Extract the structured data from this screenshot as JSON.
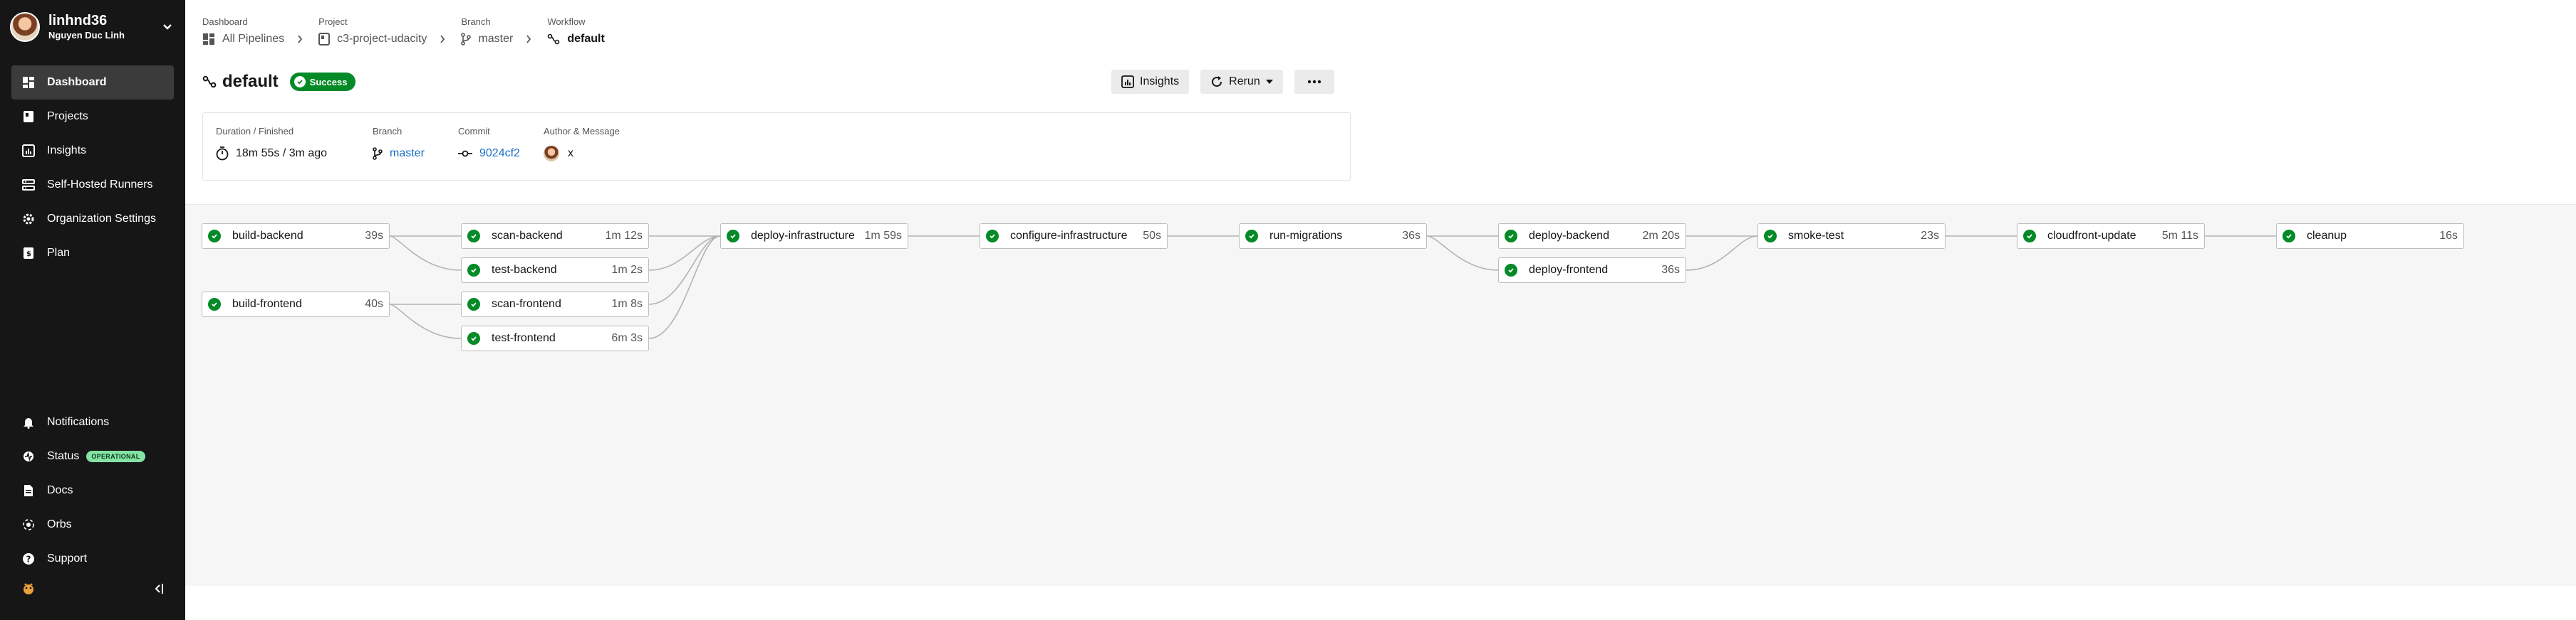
{
  "sidebar": {
    "user_name": "linhnd36",
    "user_full_name": "Nguyen Duc Linh",
    "nav_top": [
      {
        "label": "Dashboard",
        "icon": "dashboard-icon",
        "active": true
      },
      {
        "label": "Projects",
        "icon": "projects-icon"
      },
      {
        "label": "Insights",
        "icon": "insights-icon"
      },
      {
        "label": "Self-Hosted Runners",
        "icon": "runners-icon"
      },
      {
        "label": "Organization Settings",
        "icon": "gear-icon"
      },
      {
        "label": "Plan",
        "icon": "plan-icon"
      }
    ],
    "nav_bottom": [
      {
        "label": "Notifications",
        "icon": "bell-icon"
      },
      {
        "label": "Status",
        "icon": "status-icon",
        "badge": "OPERATIONAL"
      },
      {
        "label": "Docs",
        "icon": "docs-icon"
      },
      {
        "label": "Orbs",
        "icon": "orbs-icon"
      },
      {
        "label": "Support",
        "icon": "help-icon"
      }
    ]
  },
  "breadcrumb": {
    "dashboard": {
      "title": "Dashboard",
      "value": "All Pipelines"
    },
    "project": {
      "title": "Project",
      "value": "c3-project-udacity"
    },
    "branch": {
      "title": "Branch",
      "value": "master"
    },
    "workflow": {
      "title": "Workflow",
      "value": "default"
    }
  },
  "header": {
    "workflow_name": "default",
    "status": "Success",
    "insights_label": "Insights",
    "rerun_label": "Rerun"
  },
  "details": {
    "duration_label": "Duration / Finished",
    "duration_value": "18m 55s / 3m ago",
    "branch_label": "Branch",
    "branch_value": "master",
    "commit_label": "Commit",
    "commit_value": "9024cf2",
    "author_label": "Author & Message",
    "author_message": "x"
  },
  "colors": {
    "success": "#048a26",
    "sidebar_bg": "#161616",
    "link": "#1a6fc6"
  },
  "jobs": [
    {
      "name": "build-backend",
      "duration": "39s"
    },
    {
      "name": "build-frontend",
      "duration": "40s"
    },
    {
      "name": "scan-backend",
      "duration": "1m 12s"
    },
    {
      "name": "test-backend",
      "duration": "1m 2s"
    },
    {
      "name": "scan-frontend",
      "duration": "1m 8s"
    },
    {
      "name": "test-frontend",
      "duration": "6m 3s"
    },
    {
      "name": "deploy-infrastructure",
      "duration": "1m 59s"
    },
    {
      "name": "configure-infrastructure",
      "duration": "50s"
    },
    {
      "name": "run-migrations",
      "duration": "36s"
    },
    {
      "name": "deploy-backend",
      "duration": "2m 20s"
    },
    {
      "name": "deploy-frontend",
      "duration": "36s"
    },
    {
      "name": "smoke-test",
      "duration": "23s"
    },
    {
      "name": "cloudfront-update",
      "duration": "5m 11s"
    },
    {
      "name": "cleanup",
      "duration": "16s"
    }
  ]
}
